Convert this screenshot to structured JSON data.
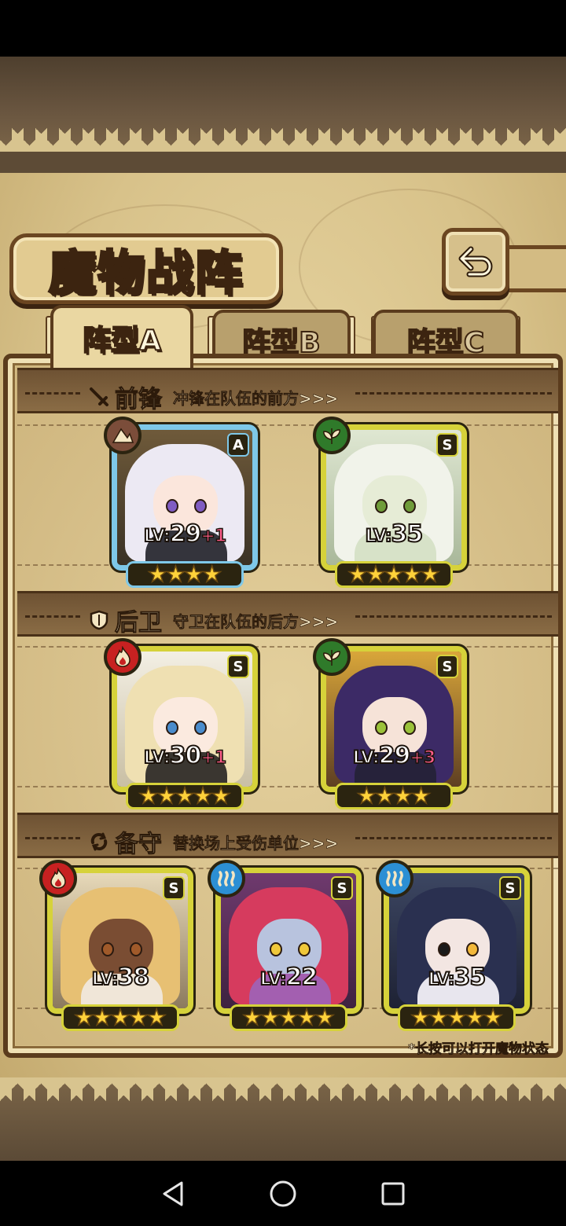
{
  "screen": {
    "title": "魔物战阵",
    "back_icon": "return-arrow-icon",
    "tabs": [
      {
        "label": "阵型A",
        "selected": true
      },
      {
        "label": "阵型B",
        "selected": false
      },
      {
        "label": "阵型C",
        "selected": false
      }
    ]
  },
  "sections": [
    {
      "id": "vanguard",
      "icon": "sword-icon",
      "title": "前锋",
      "desc": "冲锋在队伍的前方>>>"
    },
    {
      "id": "rearguard",
      "icon": "shield-icon",
      "title": "后卫",
      "desc": "守卫在队伍的后方>>>"
    },
    {
      "id": "reserve",
      "icon": "swap-icon",
      "title": "备守",
      "desc": "替换场上受伤单位>>>"
    }
  ],
  "units": {
    "vanguard": [
      {
        "element": "earth",
        "rarity": "A",
        "lv_prefix": "LV:",
        "level": "29",
        "bonus": "+1",
        "stars": 4
      },
      {
        "element": "grass",
        "rarity": "S",
        "lv_prefix": "LV:",
        "level": "35",
        "bonus": "",
        "stars": 5
      }
    ],
    "rearguard": [
      {
        "element": "fire",
        "rarity": "S",
        "lv_prefix": "LV:",
        "level": "30",
        "bonus": "+1",
        "stars": 5
      },
      {
        "element": "grass",
        "rarity": "S",
        "lv_prefix": "LV:",
        "level": "29",
        "bonus": "+3",
        "stars": 4
      }
    ],
    "reserve": [
      {
        "element": "fire",
        "rarity": "S",
        "lv_prefix": "LV:",
        "level": "38",
        "bonus": "",
        "stars": 5
      },
      {
        "element": "water",
        "rarity": "S",
        "lv_prefix": "LV:",
        "level": "22",
        "bonus": "",
        "stars": 5
      },
      {
        "element": "water",
        "rarity": "S",
        "lv_prefix": "LV:",
        "level": "35",
        "bonus": "",
        "stars": 5
      }
    ]
  },
  "footnote": "*长按可以打开魔物状态",
  "colors": {
    "parchment": "#d8c28a",
    "frame_brown": "#5b3c1d",
    "rarity_s": "#d6d23a",
    "rarity_a": "#7ec8e8",
    "star": "#ffd23a",
    "bonus": "#ff5c8a"
  },
  "nav": {
    "back": "nav-back-icon",
    "home": "nav-home-icon",
    "recents": "nav-recents-icon"
  }
}
